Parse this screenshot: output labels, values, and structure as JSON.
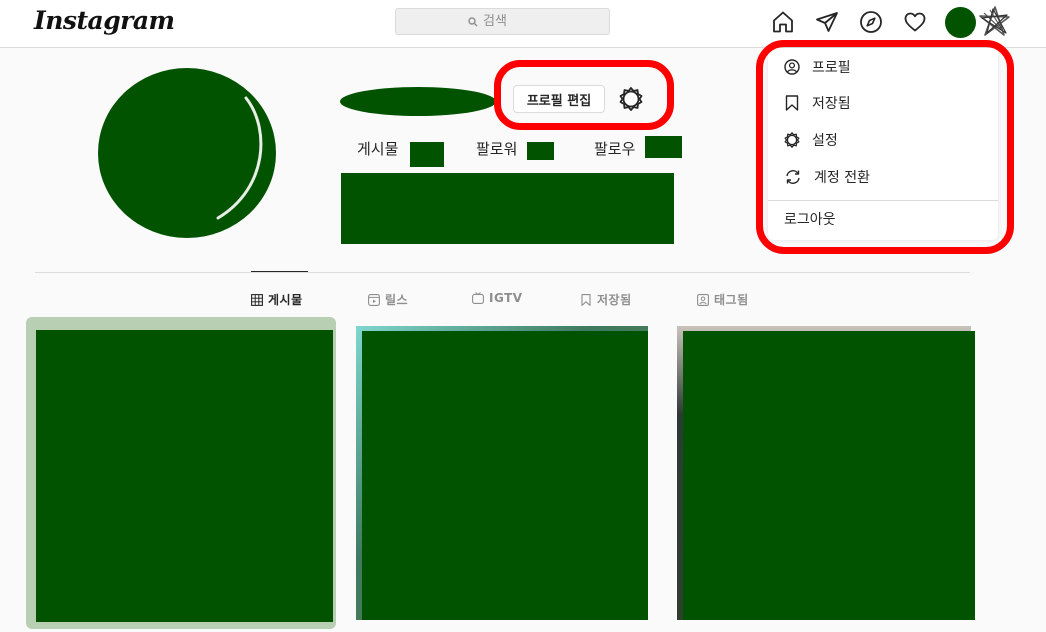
{
  "app": {
    "logo_text": "Instagram"
  },
  "search": {
    "placeholder": "검색"
  },
  "profile": {
    "edit_label": "프로필 편집",
    "stats": {
      "posts_label": "게시물",
      "followers_label": "팔로워",
      "following_label": "팔로우"
    }
  },
  "tabs": [
    {
      "label": "게시물",
      "icon": "grid-icon"
    },
    {
      "label": "릴스",
      "icon": "reels-icon"
    },
    {
      "label": "IGTV",
      "icon": "igtv-icon"
    },
    {
      "label": "저장됨",
      "icon": "bookmark-icon"
    },
    {
      "label": "태그됨",
      "icon": "tagged-icon"
    }
  ],
  "dropdown": {
    "items": [
      {
        "label": "프로필",
        "icon": "profile-icon"
      },
      {
        "label": "저장됨",
        "icon": "bookmark-icon"
      },
      {
        "label": "설정",
        "icon": "settings-icon"
      },
      {
        "label": "계정 전환",
        "icon": "switch-account-icon"
      }
    ],
    "logout_label": "로그아웃"
  },
  "colors": {
    "redaction": "#015300",
    "highlight": "#ff0000",
    "border": "#dbdbdb",
    "text": "#262626",
    "muted": "#8e8e8e"
  }
}
